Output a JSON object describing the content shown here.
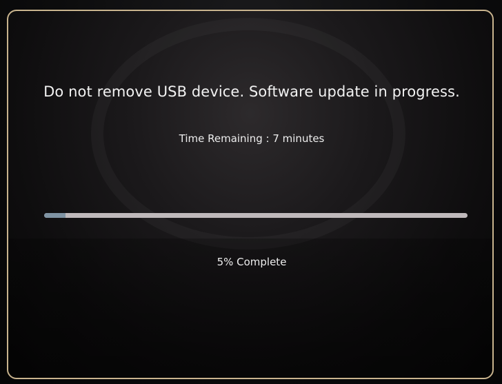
{
  "update_screen": {
    "message": "Do not remove USB device. Software update in progress.",
    "time_remaining": "Time Remaining : 7 minutes",
    "progress_fraction": 0.05,
    "progress_label": "5% Complete"
  },
  "colors": {
    "frame_border": "#c9b48e",
    "progress_track": "#bfb9bb",
    "progress_fill": "#7f93a3",
    "text": "#f2f2f2"
  }
}
